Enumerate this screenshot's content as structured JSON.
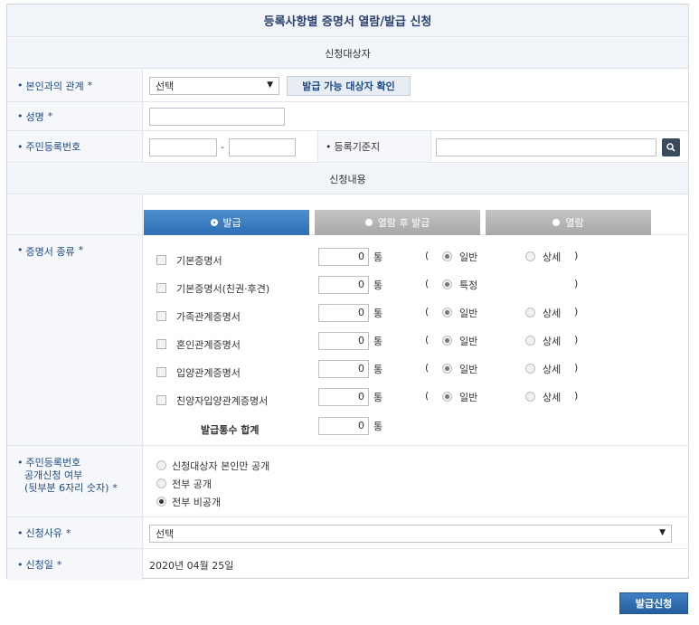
{
  "title": "등록사항별 증명서 열람/발급 신청",
  "section_target": "신청대상자",
  "section_content": "신청내용",
  "fields": {
    "relation": {
      "label": "본인과의 관계",
      "required": "*",
      "select_value": "선택",
      "check_button": "발급 가능 대상자 확인"
    },
    "name": {
      "label": "성명",
      "required": "*"
    },
    "rrn": {
      "label": "주민등록번호",
      "dash": "-"
    },
    "base_address": {
      "label": "등록기준지"
    },
    "cert_type": {
      "label": "증명서 종류",
      "required": "*"
    },
    "rrn_disclosure": {
      "label_line1": "주민등록번호",
      "label_line2": "공개신청 여부",
      "label_line3": "(뒷부분 6자리 숫자)",
      "required": "*"
    },
    "reason": {
      "label": "신청사유",
      "required": "*",
      "select_value": "선택"
    },
    "date": {
      "label": "신청일",
      "required": "*",
      "value": "2020년 04월 25일"
    }
  },
  "tabs": [
    {
      "label": "발급",
      "active": true
    },
    {
      "label": "열람 후 발급",
      "active": false
    },
    {
      "label": "열람",
      "active": false
    }
  ],
  "certificates": [
    {
      "name": "기본증명서",
      "qty": "0",
      "unit": "통",
      "opt1": "일반",
      "opt2": "상세"
    },
    {
      "name": "기본증명서(친권·후견)",
      "qty": "0",
      "unit": "통",
      "opt1": "특정",
      "opt2": ""
    },
    {
      "name": "가족관계증명서",
      "qty": "0",
      "unit": "통",
      "opt1": "일반",
      "opt2": "상세"
    },
    {
      "name": "혼인관계증명서",
      "qty": "0",
      "unit": "통",
      "opt1": "일반",
      "opt2": "상세"
    },
    {
      "name": "입양관계증명서",
      "qty": "0",
      "unit": "통",
      "opt1": "일반",
      "opt2": "상세"
    },
    {
      "name": "친양자입양관계증명서",
      "qty": "0",
      "unit": "통",
      "opt1": "일반",
      "opt2": "상세"
    }
  ],
  "paren_open": "(",
  "paren_close": ")",
  "total": {
    "label": "발급통수 합계",
    "qty": "0",
    "unit": "통"
  },
  "disclosure_options": [
    {
      "label": "신청대상자 본인만 공개",
      "selected": false
    },
    {
      "label": "전부 공개",
      "selected": false
    },
    {
      "label": "전부 비공개",
      "selected": true
    }
  ],
  "bullet": "•",
  "arrow": "▼",
  "submit_label": "발급신청",
  "colors": {
    "accent": "#2e6eb5",
    "label": "#1e4b86",
    "header_bg": "#f1f4f8"
  }
}
